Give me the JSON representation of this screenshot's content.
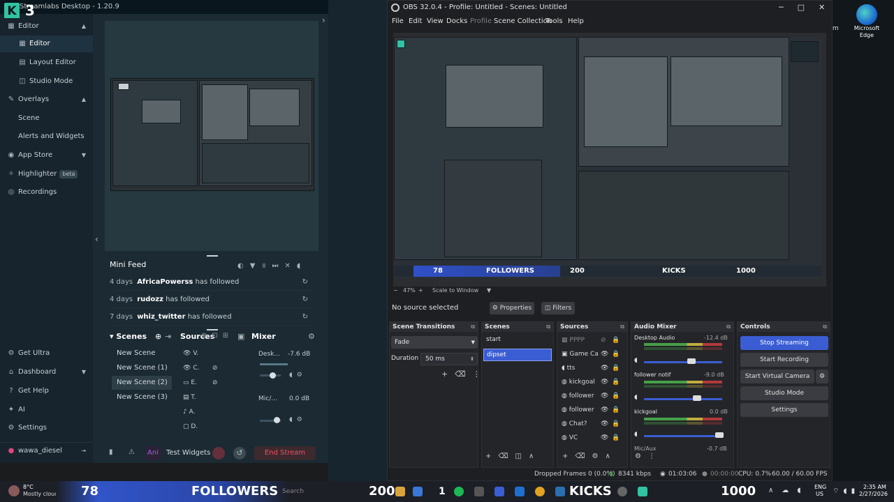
{
  "streamlabs": {
    "title": "Streamlabs Desktop - 1.20.9",
    "logo_counter": "3",
    "nav": {
      "editor": "Editor",
      "editor_sub": "Editor",
      "layout_editor": "Layout Editor",
      "studio_mode": "Studio Mode",
      "overlays": "Overlays",
      "scene": "Scene",
      "alerts": "Alerts and Widgets",
      "app_store": "App Store",
      "highlighter": "Highlighter",
      "highlighter_badge": "beta",
      "recordings": "Recordings",
      "get_ultra": "Get Ultra",
      "dashboard": "Dashboard",
      "get_help": "Get Help",
      "ai": "AI",
      "settings": "Settings",
      "user": "wawa_diesel"
    },
    "minifeed": {
      "title": "Mini Feed",
      "rows": [
        {
          "age": "4 days",
          "name": "AfricaPowerss",
          "action": "has followed"
        },
        {
          "age": "4 days",
          "name": "rudozz",
          "action": "has followed"
        },
        {
          "age": "7 days",
          "name": "whiz_twitter",
          "action": "has followed"
        }
      ]
    },
    "scenes": {
      "title": "Scenes",
      "items": [
        "New Scene",
        "New Scene (1)",
        "New Scene (2)",
        "New Scene (3)"
      ]
    },
    "sources": {
      "title": "Sources",
      "items": [
        "V.",
        "C.",
        "E.",
        "T.",
        "A.",
        "D."
      ]
    },
    "mixer": {
      "title": "Mixer",
      "channels": [
        {
          "name": "Desk...",
          "db": "-7.6 dB"
        },
        {
          "name": "Mic/...",
          "db": "0.0 dB"
        }
      ]
    },
    "footer": {
      "anim_label": "Ani",
      "test_widgets": "Test Widgets",
      "end_stream": "End Stream"
    }
  },
  "obs": {
    "title": "OBS 32.0.4 - Profile: Untitled - Scenes: Untitled",
    "menu": [
      "File",
      "Edit",
      "View",
      "Docks",
      "Profile",
      "Scene Collection",
      "Tools",
      "Help"
    ],
    "zoom": "47%",
    "scale_mode": "Scale to Window",
    "no_source": "No source selected",
    "properties": "Properties",
    "filters": "Filters",
    "transitions": {
      "title": "Scene Transitions",
      "type": "Fade",
      "duration_label": "Duration",
      "duration_value": "50 ms"
    },
    "scenes": {
      "title": "Scenes",
      "items": [
        "start",
        "dipset"
      ],
      "selected": "dipset"
    },
    "sources": {
      "title": "Sources",
      "items": [
        "PPPP",
        "Game Ca",
        "tts",
        "kickgoal",
        "follower",
        "follower",
        "Chat?",
        "VC"
      ]
    },
    "mixer": {
      "title": "Audio Mixer",
      "channels": [
        {
          "name": "Desktop Audio",
          "db": "-12.4 dB"
        },
        {
          "name": "follower notif",
          "db": "-9.0 dB"
        },
        {
          "name": "kickgoal",
          "db": "0.0 dB"
        },
        {
          "name": "Mic/Aux",
          "db": "-0.7 dB"
        }
      ]
    },
    "controls": {
      "title": "Controls",
      "stop_streaming": "Stop Streaming",
      "start_recording": "Start Recording",
      "start_virtual_camera": "Start Virtual Camera",
      "studio_mode": "Studio Mode",
      "settings": "Settings"
    },
    "status": {
      "dropped": "Dropped Frames 0 (0.0%)",
      "bitrate": "8341 kbps",
      "stream_time": "01:03:06",
      "rec_time": "00:00:00",
      "cpu": "CPU: 0.7%",
      "fps": "60.00 / 60.00 FPS"
    },
    "preview_overlay": {
      "followers_count": "78",
      "followers_label": "FOLLOWERS",
      "goal": "200",
      "kicks_label": "KICKS",
      "kicks_goal": "1000"
    }
  },
  "desktop": {
    "edge_label": "Microsoft Edge",
    "partial_label": "m"
  },
  "taskbar": {
    "weather_temp": "8°C",
    "weather_desc": "Mostly cloudy",
    "followers_count": "78",
    "followers_label": "FOLLOWERS",
    "goal": "200",
    "kicks_count": "1",
    "kicks_label": "KICKS",
    "kicks_goal": "1000",
    "search_placeholder": "Search",
    "lang": "ENG",
    "region": "US",
    "time": "2:35 AM",
    "date": "2/27/2026"
  }
}
